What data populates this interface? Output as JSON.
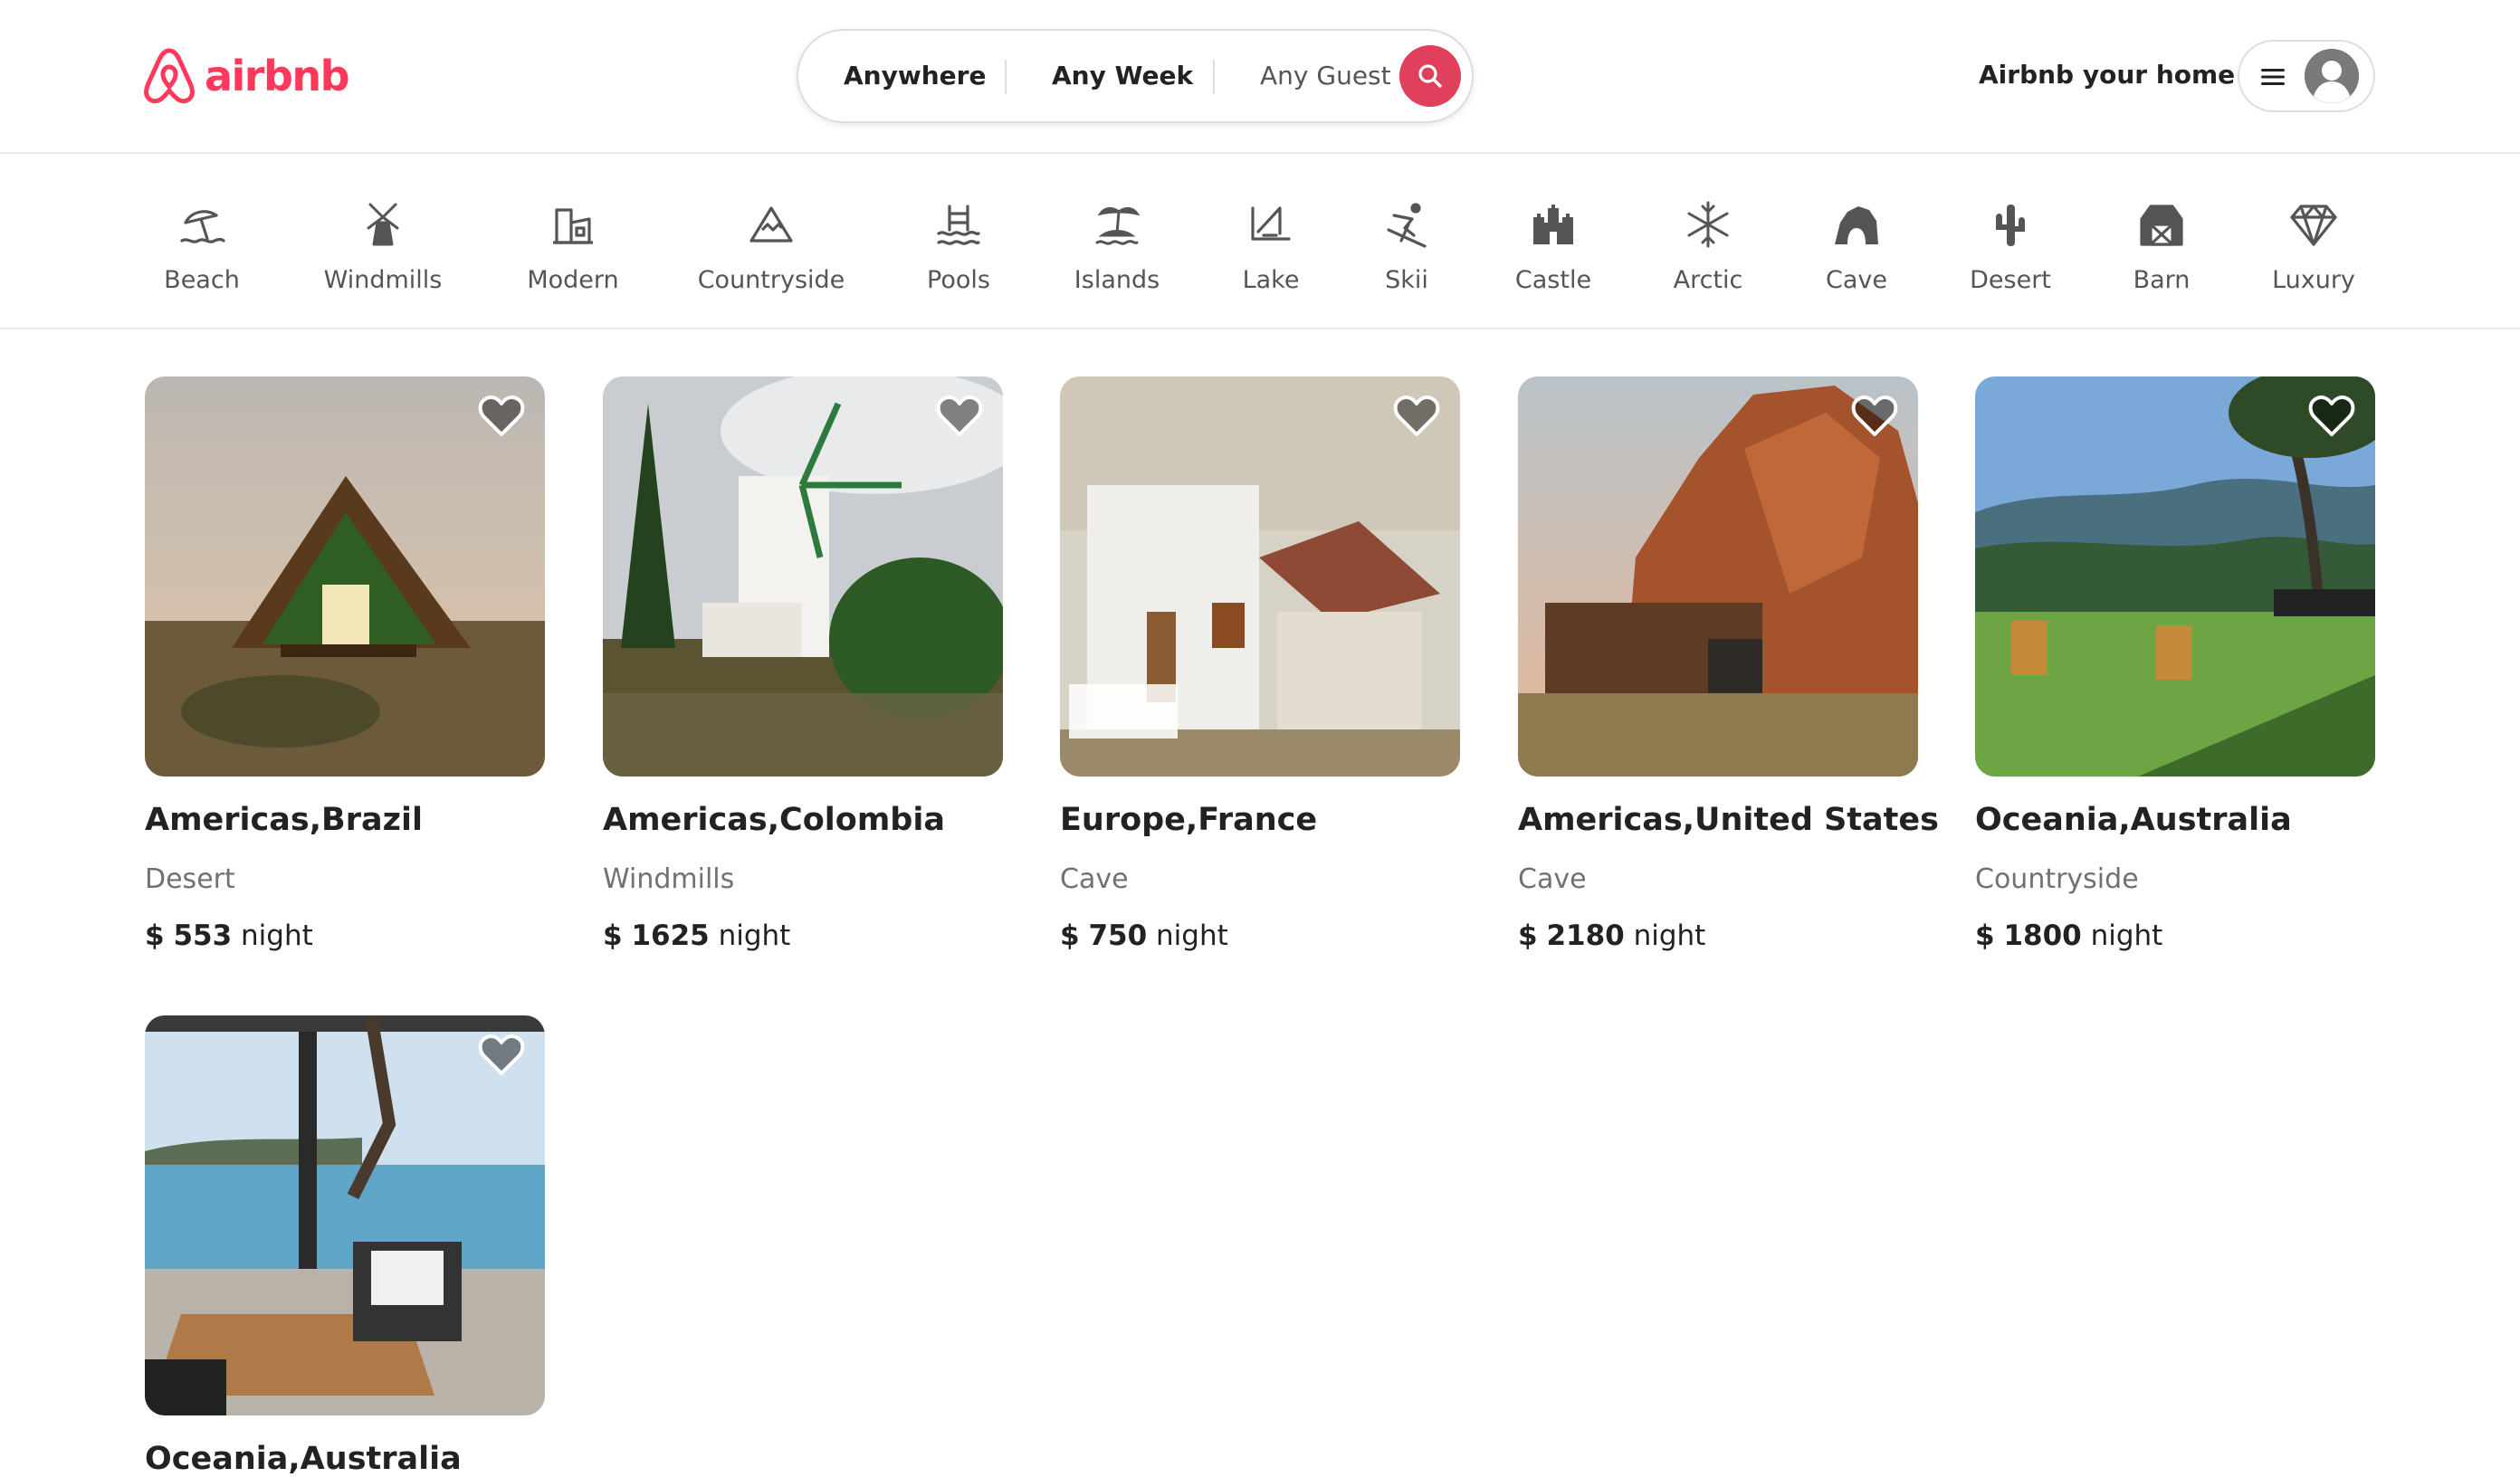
{
  "brand": {
    "name": "airbnb",
    "color": "#FF385C"
  },
  "search": {
    "location": "Anywhere",
    "dates": "Any Week",
    "guests": "Any Guest",
    "button_color": "#E0405B",
    "icon": "search-icon"
  },
  "header": {
    "host_link": "Airbnb your home",
    "menu_icon": "hamburger-menu-icon",
    "avatar_icon": "user-avatar-icon"
  },
  "categories": [
    {
      "label": "Beach",
      "icon": "beach-icon"
    },
    {
      "label": "Windmills",
      "icon": "windmill-icon"
    },
    {
      "label": "Modern",
      "icon": "modern-house-icon"
    },
    {
      "label": "Countryside",
      "icon": "mountain-icon"
    },
    {
      "label": "Pools",
      "icon": "pool-icon"
    },
    {
      "label": "Islands",
      "icon": "island-icon"
    },
    {
      "label": "Lake",
      "icon": "lake-icon"
    },
    {
      "label": "Skii",
      "icon": "ski-icon"
    },
    {
      "label": "Castle",
      "icon": "castle-icon"
    },
    {
      "label": "Arctic",
      "icon": "snowflake-icon"
    },
    {
      "label": "Cave",
      "icon": "cave-icon"
    },
    {
      "label": "Desert",
      "icon": "cactus-icon"
    },
    {
      "label": "Barn",
      "icon": "barn-icon"
    },
    {
      "label": "Luxury",
      "icon": "diamond-icon"
    }
  ],
  "listings": [
    {
      "title": "Americas,Brazil",
      "type": "Desert",
      "currency": "$",
      "price": "553",
      "unit": "night"
    },
    {
      "title": "Americas,Colombia",
      "type": "Windmills",
      "currency": "$",
      "price": "1625",
      "unit": "night"
    },
    {
      "title": "Europe,France",
      "type": "Cave",
      "currency": "$",
      "price": "750",
      "unit": "night"
    },
    {
      "title": "Americas,United States",
      "type": "Cave",
      "currency": "$",
      "price": "2180",
      "unit": "night"
    },
    {
      "title": "Oceania,Australia",
      "type": "Countryside",
      "currency": "$",
      "price": "1800",
      "unit": "night"
    },
    {
      "title": "Oceania,Australia",
      "type": "",
      "currency": "",
      "price": "",
      "unit": ""
    }
  ]
}
